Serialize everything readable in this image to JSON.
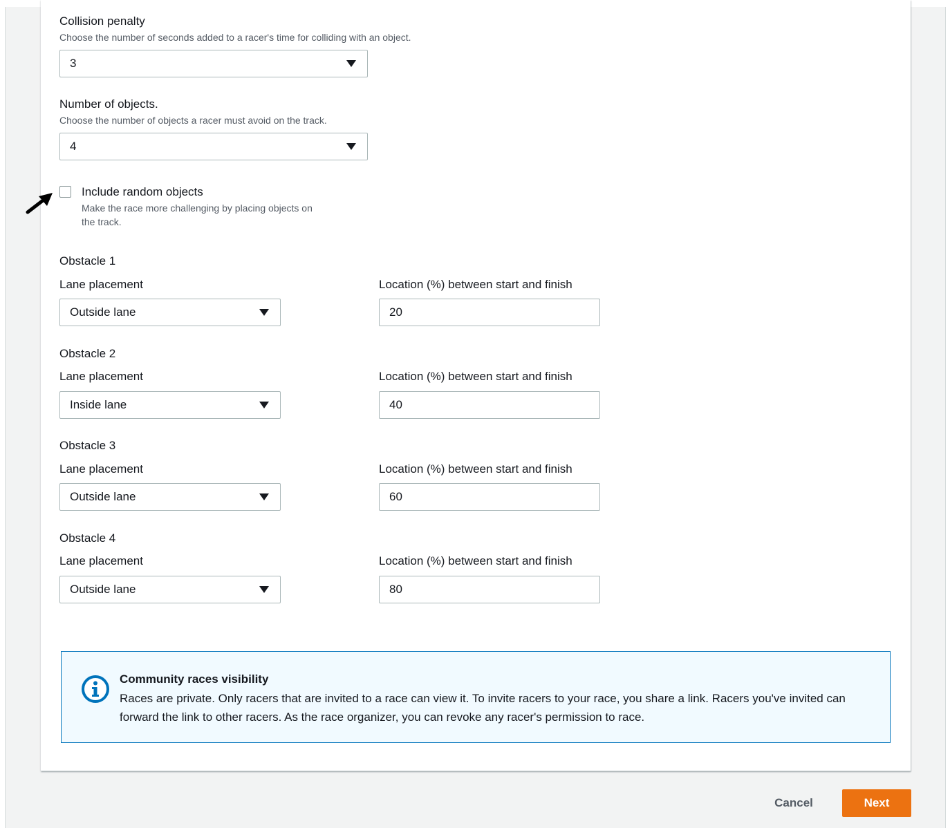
{
  "collision": {
    "label": "Collision penalty",
    "description": "Choose the number of seconds added to a racer's time for colliding with an object.",
    "value": "3"
  },
  "objects_count": {
    "label": "Number of objects.",
    "description": "Choose the number of objects a racer must avoid on the track.",
    "value": "4"
  },
  "random_objects": {
    "label": "Include random objects",
    "description_line1": "Make the race more challenging by placing objects on",
    "description_line2": "the track.",
    "checked": false
  },
  "obstacles": [
    {
      "title": "Obstacle 1",
      "lane_label": "Lane placement",
      "lane": "Outside lane",
      "location_label": "Location (%) between start and finish",
      "location": "20"
    },
    {
      "title": "Obstacle 2",
      "lane_label": "Lane placement",
      "lane": "Inside lane",
      "location_label": "Location (%) between start and finish",
      "location": "40"
    },
    {
      "title": "Obstacle 3",
      "lane_label": "Lane placement",
      "lane": "Outside lane",
      "location_label": "Location (%) between start and finish",
      "location": "60"
    },
    {
      "title": "Obstacle 4",
      "lane_label": "Lane placement",
      "lane": "Outside lane",
      "location_label": "Location (%) between start and finish",
      "location": "80"
    }
  ],
  "alert": {
    "icon": "info-icon",
    "title": "Community races visibility",
    "body": "Races are private. Only racers that are invited to a race can view it. To invite racers to your race, you share a link. Racers you've invited can forward the link to other racers. As the race organizer, you can revoke any racer's permission to race."
  },
  "actions": {
    "cancel": "Cancel",
    "next": "Next"
  },
  "colors": {
    "accent": "#ec7211",
    "info_border": "#0073bb",
    "info_bg": "#f1faff"
  }
}
